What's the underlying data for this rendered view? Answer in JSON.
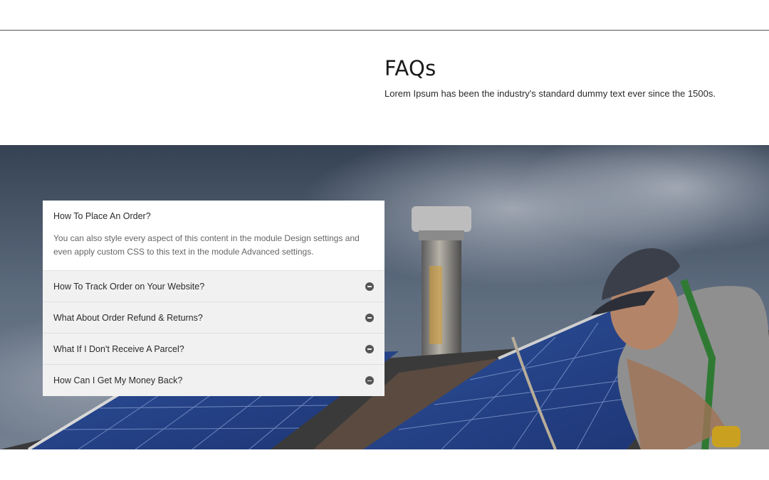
{
  "intro": {
    "title": "FAQs",
    "text": "Lorem Ipsum has been the industry's standard dummy text ever since the 1500s."
  },
  "hero": {
    "image": "worker-installing-solar-panels-photo"
  },
  "faq": {
    "open": {
      "question": "How To Place An Order?",
      "answer": "You can also style every aspect of this content in the module Design settings and even apply custom CSS to this text in the module Advanced settings."
    },
    "items": [
      {
        "question": "How To Track Order on Your Website?",
        "icon": "minus-circle-icon"
      },
      {
        "question": "What About Order Refund & Returns?",
        "icon": "minus-circle-icon"
      },
      {
        "question": "What If I Don't Receive A Parcel?",
        "icon": "minus-circle-icon"
      },
      {
        "question": "How Can I Get My Money Back?",
        "icon": "minus-circle-icon"
      }
    ]
  }
}
